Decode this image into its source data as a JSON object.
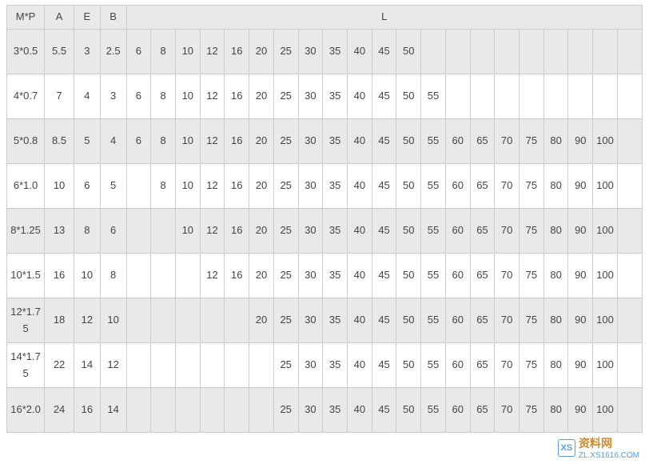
{
  "chart_data": {
    "type": "table",
    "title": "",
    "columns": [
      "M*P",
      "A",
      "E",
      "B",
      "L"
    ],
    "L_column_count": 21,
    "rows": [
      {
        "mp": "3*0.5",
        "a": "5.5",
        "e": "3",
        "b": "2.5",
        "l": [
          "6",
          "8",
          "10",
          "12",
          "16",
          "20",
          "25",
          "30",
          "35",
          "40",
          "45",
          "50",
          "",
          "",
          "",
          "",
          "",
          "",
          "",
          "",
          ""
        ]
      },
      {
        "mp": "4*0.7",
        "a": "7",
        "e": "4",
        "b": "3",
        "l": [
          "6",
          "8",
          "10",
          "12",
          "16",
          "20",
          "25",
          "30",
          "35",
          "40",
          "45",
          "50",
          "55",
          "",
          "",
          "",
          "",
          "",
          "",
          "",
          ""
        ]
      },
      {
        "mp": "5*0.8",
        "a": "8.5",
        "e": "5",
        "b": "4",
        "l": [
          "6",
          "8",
          "10",
          "12",
          "16",
          "20",
          "25",
          "30",
          "35",
          "40",
          "45",
          "50",
          "55",
          "60",
          "65",
          "70",
          "75",
          "80",
          "90",
          "100",
          ""
        ]
      },
      {
        "mp": "6*1.0",
        "a": "10",
        "e": "6",
        "b": "5",
        "l": [
          "",
          "8",
          "10",
          "12",
          "16",
          "20",
          "25",
          "30",
          "35",
          "40",
          "45",
          "50",
          "55",
          "60",
          "65",
          "70",
          "75",
          "80",
          "90",
          "100",
          ""
        ]
      },
      {
        "mp": "8*1.25",
        "a": "13",
        "e": "8",
        "b": "6",
        "l": [
          "",
          "",
          "10",
          "12",
          "16",
          "20",
          "25",
          "30",
          "35",
          "40",
          "45",
          "50",
          "55",
          "60",
          "65",
          "70",
          "75",
          "80",
          "90",
          "100",
          ""
        ]
      },
      {
        "mp": "10*1.5",
        "a": "16",
        "e": "10",
        "b": "8",
        "l": [
          "",
          "",
          "",
          "12",
          "16",
          "20",
          "25",
          "30",
          "35",
          "40",
          "45",
          "50",
          "55",
          "60",
          "65",
          "70",
          "75",
          "80",
          "90",
          "100",
          ""
        ]
      },
      {
        "mp": "12*1.75",
        "a": "18",
        "e": "12",
        "b": "10",
        "l": [
          "",
          "",
          "",
          "",
          "",
          "20",
          "25",
          "30",
          "35",
          "40",
          "45",
          "50",
          "55",
          "60",
          "65",
          "70",
          "75",
          "80",
          "90",
          "100",
          ""
        ]
      },
      {
        "mp": "14*1.75",
        "a": "22",
        "e": "14",
        "b": "12",
        "l": [
          "",
          "",
          "",
          "",
          "",
          "",
          "25",
          "30",
          "35",
          "40",
          "45",
          "50",
          "55",
          "60",
          "65",
          "70",
          "75",
          "80",
          "90",
          "100",
          ""
        ]
      },
      {
        "mp": "16*2.0",
        "a": "24",
        "e": "16",
        "b": "14",
        "l": [
          "",
          "",
          "",
          "",
          "",
          "",
          "25",
          "30",
          "35",
          "40",
          "45",
          "50",
          "55",
          "60",
          "65",
          "70",
          "75",
          "80",
          "90",
          "100",
          ""
        ]
      }
    ]
  },
  "headers": {
    "mp": "M*P",
    "a": "A",
    "e": "E",
    "b": "B",
    "l": "L"
  },
  "watermark": {
    "logo": "XS",
    "text": "资料网",
    "url": "ZL.XS1616.COM"
  }
}
